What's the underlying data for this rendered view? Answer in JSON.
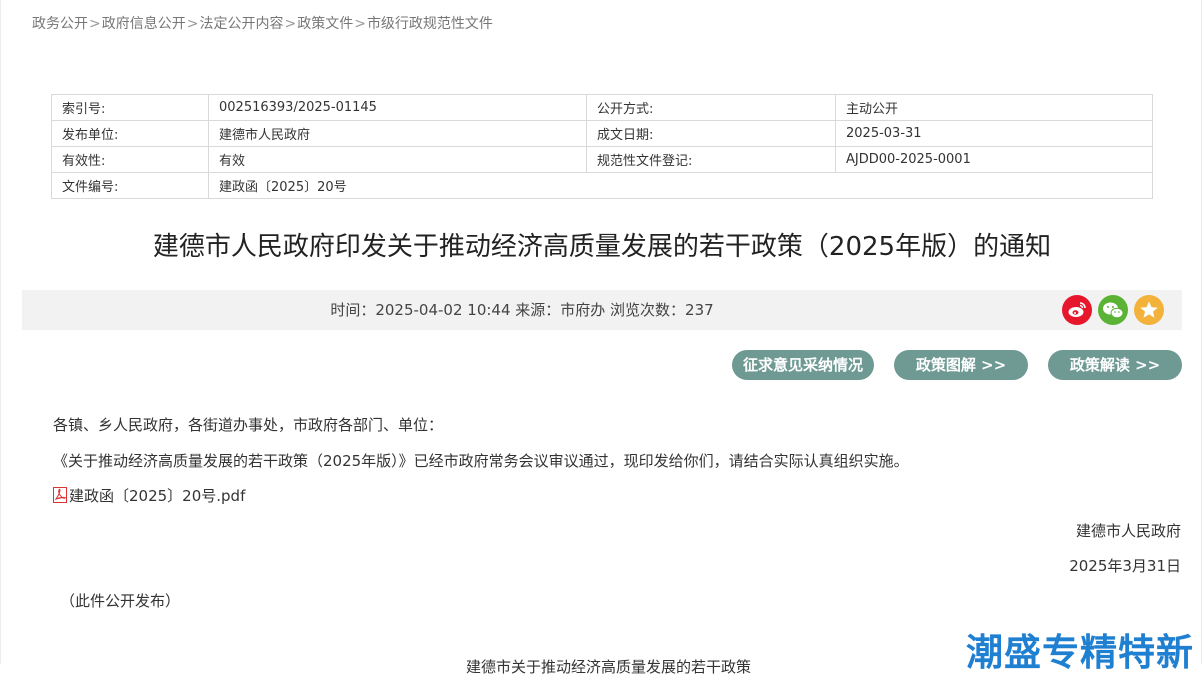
{
  "breadcrumb": [
    "政务公开",
    "政府信息公开",
    "法定公开内容",
    "政策文件",
    "市级行政规范性文件"
  ],
  "breadcrumb_sep": ">",
  "meta": {
    "index_label": "索引号:",
    "index_value": "002516393/2025-01145",
    "open_mode_label": "公开方式:",
    "open_mode_value": "主动公开",
    "publisher_label": "发布单位:",
    "publisher_value": "建德市人民政府",
    "date_label": "成文日期:",
    "date_value": "2025-03-31",
    "validity_label": "有效性:",
    "validity_value": "有效",
    "reg_label": "规范性文件登记:",
    "reg_value": "AJDD00-2025-0001",
    "docno_label": "文件编号:",
    "docno_value": "建政函〔2025〕20号"
  },
  "title": "建德市人民政府印发关于推动经济高质量发展的若干政策（2025年版）的通知",
  "info": "时间：2025-04-02 10:44 来源：市府办 浏览次数：237",
  "share_icons": [
    "weibo-icon",
    "wechat-icon",
    "favorite-icon"
  ],
  "buttons": {
    "feedback": "征求意见采纳情况",
    "graphic": "政策图解 >>",
    "interpret": "政策解读 >>"
  },
  "body": {
    "salutation": "各镇、乡人民政府，各街道办事处，市政府各部门、单位：",
    "paragraph": "《关于推动经济高质量发展的若干政策（2025年版）》已经市政府常务会议审议通过，现印发给你们，请结合实际认真组织实施。",
    "attachment": "建政函〔2025〕20号.pdf",
    "signer": "建德市人民政府",
    "sign_date": "2025年3月31日",
    "note": "（此件公开发布）",
    "next_title_partial": "建德市关于推动经济高质量发展的若干政策"
  },
  "watermark": "潮盛专精特新",
  "colors": {
    "button_bg": "#6f9a94",
    "weibo": "#e6162d",
    "wechat": "#5bb335",
    "favorite": "#f3b23a",
    "watermark": "#1f7fd1"
  }
}
